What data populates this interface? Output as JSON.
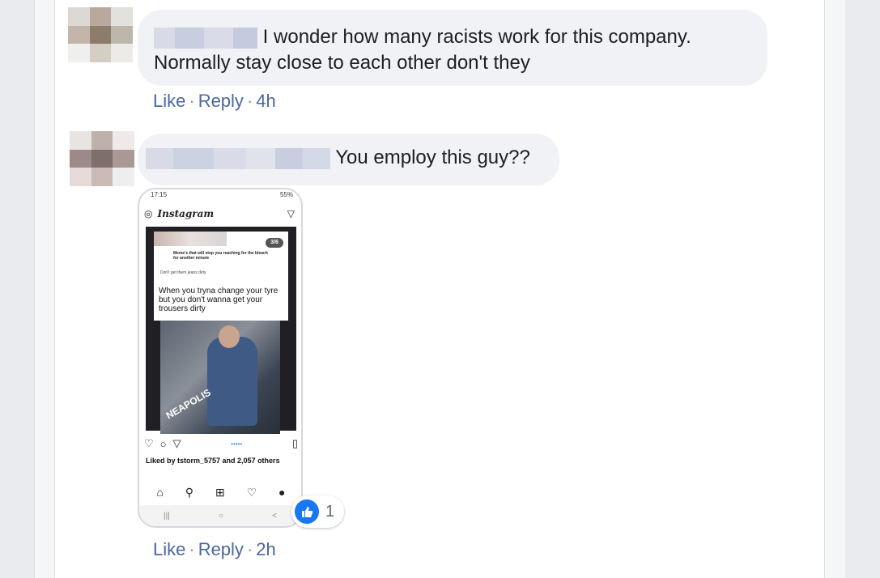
{
  "comments": [
    {
      "text_line1": "I wonder how many racists work for this company.",
      "text_line2": "Normally stay close to each other don't they",
      "like_label": "Like",
      "reply_label": "Reply",
      "time": "4h"
    },
    {
      "text": "You employ this guy??",
      "like_label": "Like",
      "reply_label": "Reply",
      "time": "2h",
      "reaction_count": "1",
      "reaction_icon": "thumbs-up-icon",
      "screenshot": {
        "status_time": "17:15",
        "status_battery": "55%",
        "app_name": "Instagram",
        "story_counter": "3/6",
        "post_header": "Meme's that will stop you reaching for the bleach for another minute",
        "post_caption": "Don't get them jeans dirty",
        "meme_text": "When you tryna change your tyre but you don't wanna get your trousers dirty",
        "car_text": "NEAPOLIS",
        "liked_by": "Liked by tstorm_5757 and 2,057 others"
      }
    }
  ],
  "colors": {
    "bubble": "#f0f2f5",
    "link": "#4b67a1",
    "accent": "#1877f2"
  }
}
